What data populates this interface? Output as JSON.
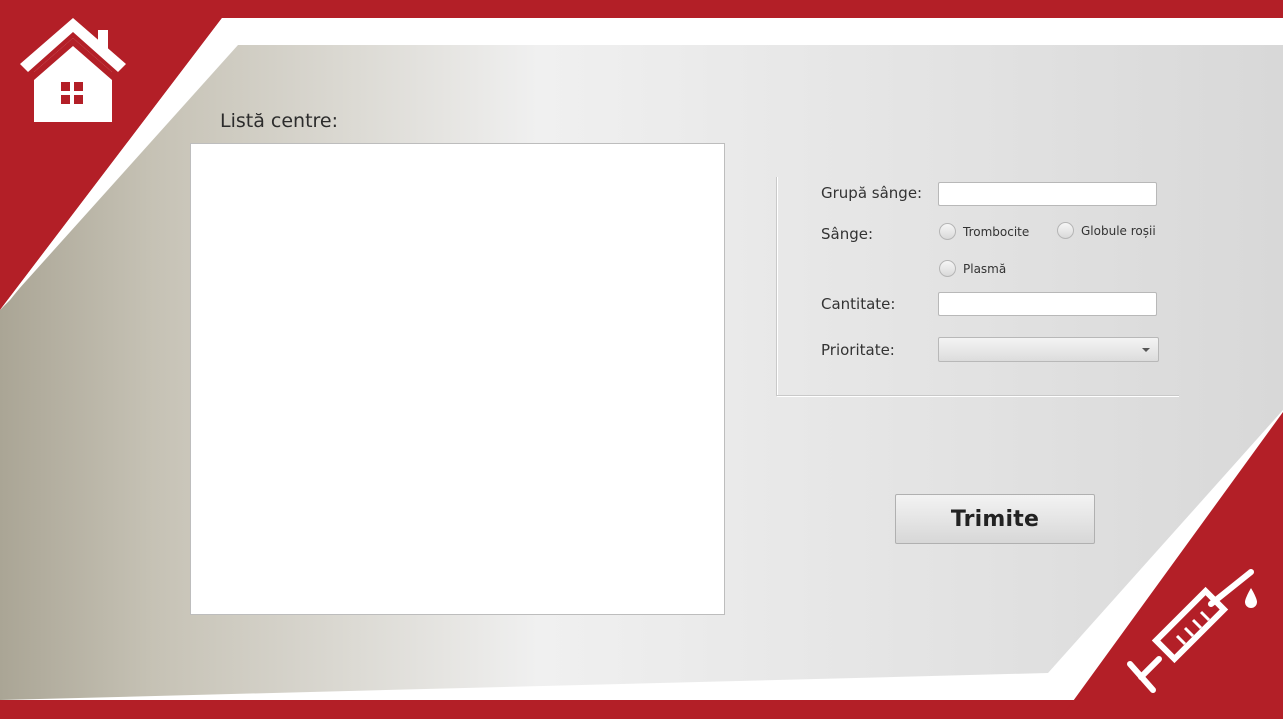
{
  "colors": {
    "brand_red": "#b31f27",
    "panel_light": "#f0f0f0",
    "panel_dark": "#aaa595"
  },
  "icons": {
    "home": "home-icon",
    "syringe": "syringe-icon"
  },
  "list": {
    "label": "Listă centre:"
  },
  "form": {
    "blood_group_label": "Grupă sânge:",
    "blood_group_value": "",
    "blood_label": "Sânge:",
    "options": {
      "platelets": "Trombocite",
      "red_cells": "Globule roșii",
      "plasma": "Plasmă"
    },
    "quantity_label": "Cantitate:",
    "quantity_value": "",
    "priority_label": "Prioritate:",
    "priority_selected": ""
  },
  "submit_label": "Trimite"
}
